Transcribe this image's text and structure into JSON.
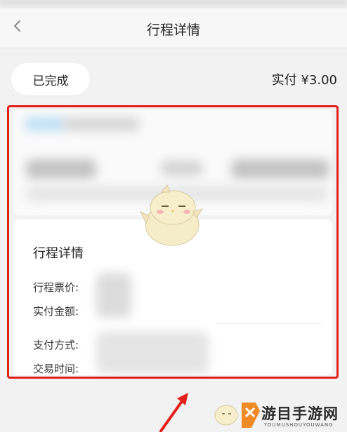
{
  "header": {
    "title": "行程详情"
  },
  "order": {
    "status": "已完成",
    "paid_summary": "实付 ¥3.00"
  },
  "detail": {
    "section_title": "行程详情",
    "rows": [
      {
        "label": "行程票价:"
      },
      {
        "label": "实付金额:"
      },
      {
        "label": "支付方式:"
      },
      {
        "label": "交易时间:"
      }
    ]
  },
  "watermark": {
    "text": "游目手游网",
    "sub": "YOUMUSHOUYOUWANG"
  },
  "colors": {
    "highlight_border": "#e3201b",
    "watermark_accent": "#f08a24"
  }
}
